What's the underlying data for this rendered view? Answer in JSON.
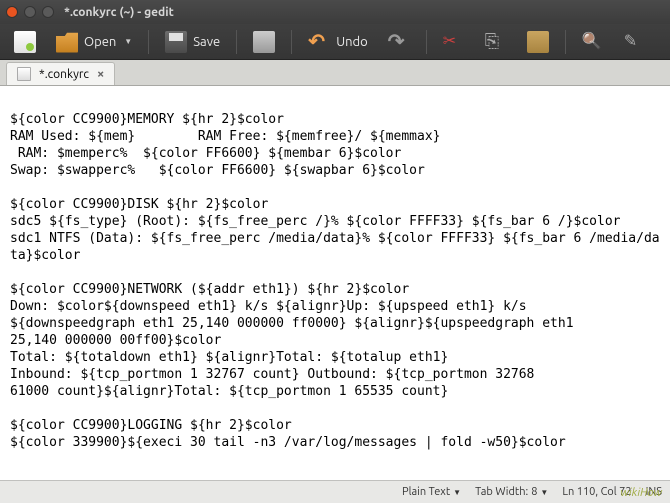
{
  "window": {
    "title": "*.conkyrc (~) - gedit"
  },
  "toolbar": {
    "open_label": "Open",
    "save_label": "Save",
    "undo_label": "Undo"
  },
  "tab": {
    "name": "*.conkyrc"
  },
  "editor_lines": [
    "",
    "${color CC9900}MEMORY ${hr 2}$color",
    "RAM Used: ${mem}        RAM Free: ${memfree}/ ${memmax}",
    " RAM: $memperc%  ${color FF6600} ${membar 6}$color",
    "Swap: $swapperc%   ${color FF6600} ${swapbar 6}$color",
    "",
    "${color CC9900}DISK ${hr 2}$color",
    "sdc5 ${fs_type} (Root): ${fs_free_perc /}% ${color FFFF33} ${fs_bar 6 /}$color",
    "sdc1 NTFS (Data): ${fs_free_perc /media/data}% ${color FFFF33} ${fs_bar 6 /media/data}$color",
    "",
    "${color CC9900}NETWORK (${addr eth1}) ${hr 2}$color",
    "Down: $color${downspeed eth1} k/s ${alignr}Up: ${upspeed eth1} k/s",
    "${downspeedgraph eth1 25,140 000000 ff0000} ${alignr}${upspeedgraph eth1",
    "25,140 000000 00ff00}$color",
    "Total: ${totaldown eth1} ${alignr}Total: ${totalup eth1}",
    "Inbound: ${tcp_portmon 1 32767 count} Outbound: ${tcp_portmon 32768 ",
    "61000 count}${alignr}Total: ${tcp_portmon 1 65535 count}",
    "",
    "${color CC9900}LOGGING ${hr 2}$color",
    "${color 339900}${execi 30 tail -n3 /var/log/messages | fold -w50}$color"
  ],
  "status": {
    "syntax": "Plain Text",
    "tab_width_label": "Tab Width:",
    "tab_width": "8",
    "position": "Ln 110, Col 72",
    "ins_mode": "INS"
  },
  "watermark": "wikiHow"
}
